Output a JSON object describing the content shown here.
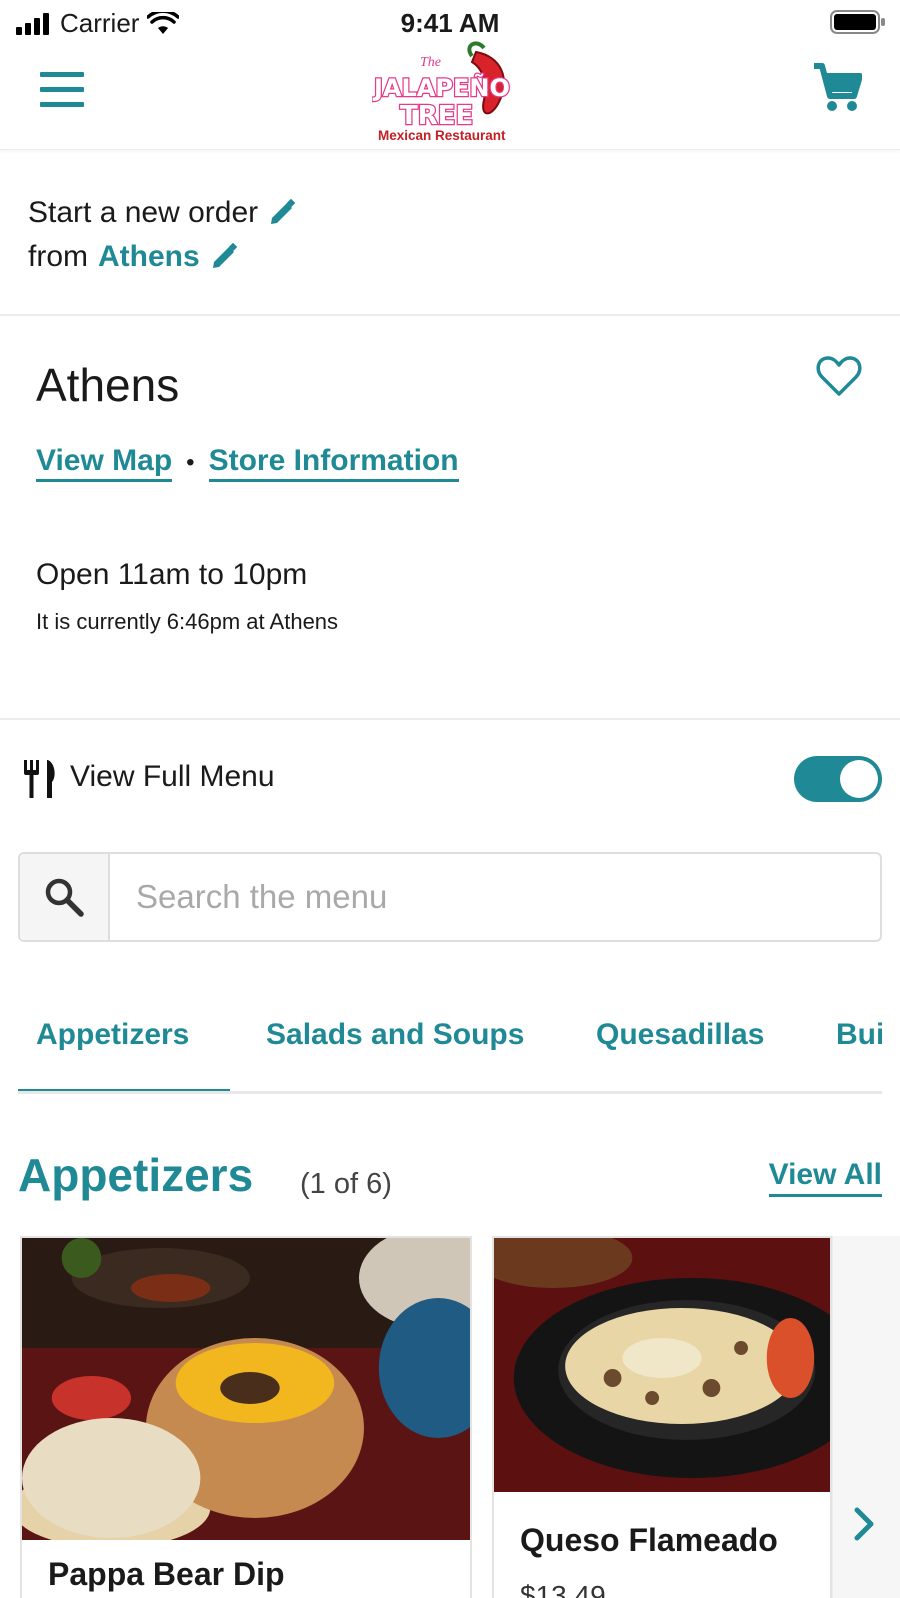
{
  "status_bar": {
    "carrier": "Carrier",
    "time": "9:41 AM"
  },
  "header": {
    "logo_text_top": "The",
    "logo_text_line1": "JALAPEÑO",
    "logo_text_line2": "TREE",
    "logo_text_tagline": "Mexican Restaurant"
  },
  "order": {
    "line1": "Start a new order",
    "line2_prefix": "from",
    "location": "Athens"
  },
  "store": {
    "name": "Athens",
    "view_map": "View Map",
    "separator": "•",
    "store_information": "Store Information",
    "hours": "Open 11am to 10pm",
    "current_time_note": "It is currently 6:46pm at Athens"
  },
  "menu_toggle": {
    "label": "View Full Menu",
    "enabled": true
  },
  "search": {
    "placeholder": "Search the menu",
    "value": ""
  },
  "category_tabs": [
    {
      "label": "Appetizers",
      "active": true
    },
    {
      "label": "Salads and Soups",
      "active": false
    },
    {
      "label": "Quesadillas",
      "active": false
    },
    {
      "label": "Bui",
      "active": false
    }
  ],
  "section": {
    "title": "Appetizers",
    "count": "(1 of 6)",
    "view_all": "View All"
  },
  "items": [
    {
      "name": "Pappa Bear Dip"
    },
    {
      "name": "Queso Flameado",
      "price": "$13.49"
    }
  ],
  "colors": {
    "accent": "#1f8a95",
    "divider": "#ececec"
  }
}
